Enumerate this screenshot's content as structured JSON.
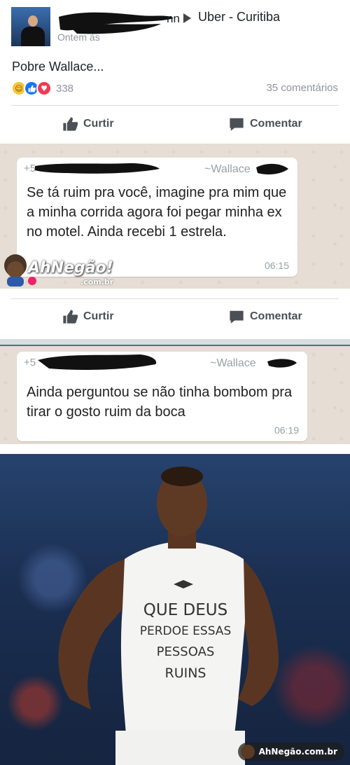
{
  "post": {
    "author_suffix": "nn",
    "group": "Uber - Curitiba",
    "timestamp": "Ontem às",
    "caption": "Pobre Wallace...",
    "reaction_count": "338",
    "comments": "35 comentários",
    "like_label": "Curtir",
    "comment_label": "Comentar"
  },
  "chat1": {
    "sender_prefix": "+5",
    "sender_name": "~Wallace",
    "message": "Se tá ruim pra você, imagine pra mim que a minha corrida agora foi pegar minha ex no motel. Ainda recebi 1 estrela.",
    "time": "06:15"
  },
  "watermark": {
    "text": "AhNegão!",
    "sub": ".com.br"
  },
  "bar2": {
    "like_label": "Curtir",
    "comment_label": "Comentar"
  },
  "chat2": {
    "sender_prefix": "+5",
    "sender_name": "~Wallace",
    "message": "Ainda perguntou se não tinha bombom pra tirar o gosto ruim da boca",
    "time": "06:19"
  },
  "photo": {
    "shirt_text": [
      "QUE DEUS",
      "PERDOE ESSAS",
      "PESSOAS",
      "RUINS"
    ],
    "watermark": "AhNegão.com.br"
  },
  "colors": {
    "fb_blue": "#1877f2",
    "wa_bg": "#e6ddd4",
    "text_gray": "#90949c"
  },
  "icons": [
    "thumbs-up-icon",
    "comment-icon",
    "arrow-right-icon",
    "haha-icon",
    "like-icon",
    "love-icon"
  ]
}
